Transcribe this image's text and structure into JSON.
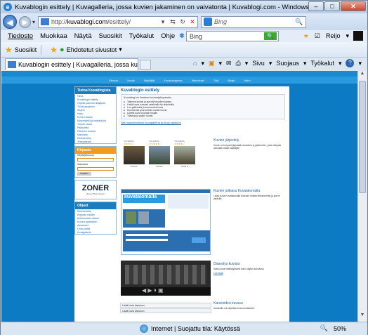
{
  "window": {
    "title": "Kuvablogin esittely | Kuvagalleria, jossa kuvien jakaminen on vaivatonta | Kuvablogi.com - Windows Internet Explorer",
    "minimize": "–",
    "maximize": "□",
    "close": "✕"
  },
  "address": {
    "url_prefix": "http://",
    "url_host": "kuvablogi.com",
    "url_path": "/esittely/",
    "search_placeholder": "Bing"
  },
  "menu": {
    "items": [
      "Tiedosto",
      "Muokkaa",
      "Näytä",
      "Suosikit",
      "Työkalut",
      "Ohje"
    ],
    "bing_value": "Bing",
    "user": "Reijo"
  },
  "favorites": {
    "favorites_label": "Suosikit",
    "suggested_label": "Ehdotetut sivustot"
  },
  "tabs": {
    "active_title": "Kuvablogin esittely | Kuvagalleria, jossa kuvien ja...",
    "commands": [
      "Sivu",
      "Suojaus",
      "Työkalut"
    ]
  },
  "site": {
    "nav": [
      "Etusivu",
      "Kuvat",
      "Käyttäjät",
      "Kuvakaappaus",
      "Mainokset",
      "Tuki",
      "Blogit",
      "Haku"
    ],
    "left": {
      "box1_title": "Tietoa Kuvablogista",
      "box1_items": [
        "Hinta",
        "Kuvablogin esittely",
        "Ohjeita palvelun käyttöön",
        "Tulostuspalvelu",
        "Ohjeet",
        "Haku",
        "Kuvien lataus",
        "Kysymyksiä ja vastauksia",
        "Yleiset ehdot",
        "Palautetta",
        "Palvelun kuvaus",
        "Mainosta",
        "Rekisteröidy",
        "Yhteystiedot"
      ],
      "box2_title": "Kirjaudu",
      "username_label": "Käyttäjätunnus",
      "password_label": "Salasana",
      "login_button": "Kirjaudu",
      "zoner_logo": "ZONER",
      "zoner_sub": "Zoner Photo Studio",
      "box3_title": "Ohjeet",
      "box3_items": [
        "Rekisteröidy",
        "Kirjaudu sisään",
        "Aloita kuvien lataus",
        "Kuvien jakaminen",
        "Asetukset",
        "Oma profiili",
        "Kuvagalleria"
      ]
    },
    "main": {
      "title": "Kuvablogin esittely",
      "intro_head": "Kuvablogi on ilmainen kuvienjakopalvelu",
      "intro_points": [
        "Tallenna kuvasi ja jaa niitä muiden kanssa",
        "Lisää kuvia suoraan selaimella tai ohjelmalla",
        "Luo gallerioita ja kommentoi kuvia",
        "Kommentoi ja arvostele muiden kuvia",
        "Lähetä kuvia suoraan blogiin",
        "Tilastoja ja paljon muuta"
      ],
      "intro_link": "Ota maksuttomasti kuvagalleria ja blogi käyttöön"
    },
    "gallery": {
      "ratings": [
        "*93.3333%",
        "*93.3333%",
        "*93.3333%"
      ],
      "stars": [
        "★★★★☆",
        "★★★★★",
        "★★★★☆"
      ],
      "captions": [
        "Kuva 1",
        "Kuva 2",
        "Kuva 3"
      ]
    },
    "sections": [
      {
        "title": "Kuvien järjestely",
        "text": "Kuvat voi helposti järjestää kansioihin ja gallerioihin, jotka näkyvät selkeästi muille käyttäjille."
      },
      {
        "title": "Kuvien julkaisu Kuvatalomalla",
        "text": "Lisää kuvia Kuvatalomalla suoraan omalta tietokoneelta ja jaa ne ystäville."
      },
      {
        "title": "Diaesitys kuvista",
        "text": "Katso kuvat diaesityksenä koko näytön kokoisina.",
        "more": "Lue lisää"
      },
      {
        "title": "Kansioiden kuvaus",
        "text": "Kansioille voi kirjoittaa oman kuvauksen."
      }
    ],
    "bottom_blocks": [
      "Lisää kuvia kansioon",
      "Lisää kuvia kansioon"
    ]
  },
  "status": {
    "zone": "Internet | Suojattu tila: Käytössä",
    "zoom": "50%"
  },
  "colors": {
    "site_bg": "#0d7bc4",
    "accent_orange": "#f29b1d",
    "link_blue": "#1c5f98"
  }
}
